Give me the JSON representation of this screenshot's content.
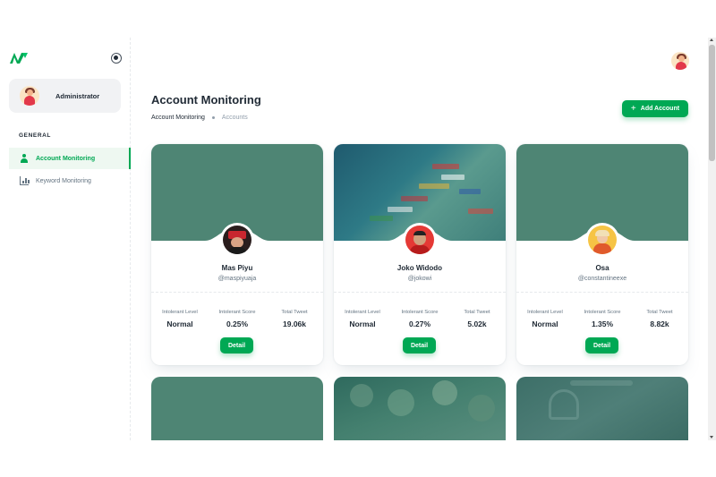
{
  "sidebar": {
    "user_name": "Administrator",
    "section_label": "GENERAL",
    "items": [
      {
        "label": "Account Monitoring",
        "icon": "person-icon",
        "active": true
      },
      {
        "label": "Keyword Monitoring",
        "icon": "chart-icon",
        "active": false
      }
    ]
  },
  "header": {
    "title": "Account Monitoring",
    "breadcrumb": [
      "Account Monitoring",
      "Accounts"
    ],
    "add_button": "Add Account",
    "add_icon": "+"
  },
  "colors": {
    "accent": "#00a854",
    "cover": "#4e8574"
  },
  "cards": [
    {
      "name": "Mas Piyu",
      "handle": "@maspiyuaja",
      "stats": [
        {
          "label": "Intolerant Level",
          "value": "Normal"
        },
        {
          "label": "Intolerant Score",
          "value": "0.25%"
        },
        {
          "label": "Total Tweet",
          "value": "19.06k"
        }
      ],
      "button": "Detail"
    },
    {
      "name": "Joko Widodo",
      "handle": "@jokowi",
      "stats": [
        {
          "label": "Intolerant Level",
          "value": "Normal"
        },
        {
          "label": "Intolerant Score",
          "value": "0.27%"
        },
        {
          "label": "Total Tweet",
          "value": "5.02k"
        }
      ],
      "button": "Detail"
    },
    {
      "name": "Osa",
      "handle": "@constantineexe",
      "stats": [
        {
          "label": "Intolerant Level",
          "value": "Normal"
        },
        {
          "label": "Intolerant Score",
          "value": "1.35%"
        },
        {
          "label": "Total Tweet",
          "value": "8.82k"
        }
      ],
      "button": "Detail"
    }
  ]
}
